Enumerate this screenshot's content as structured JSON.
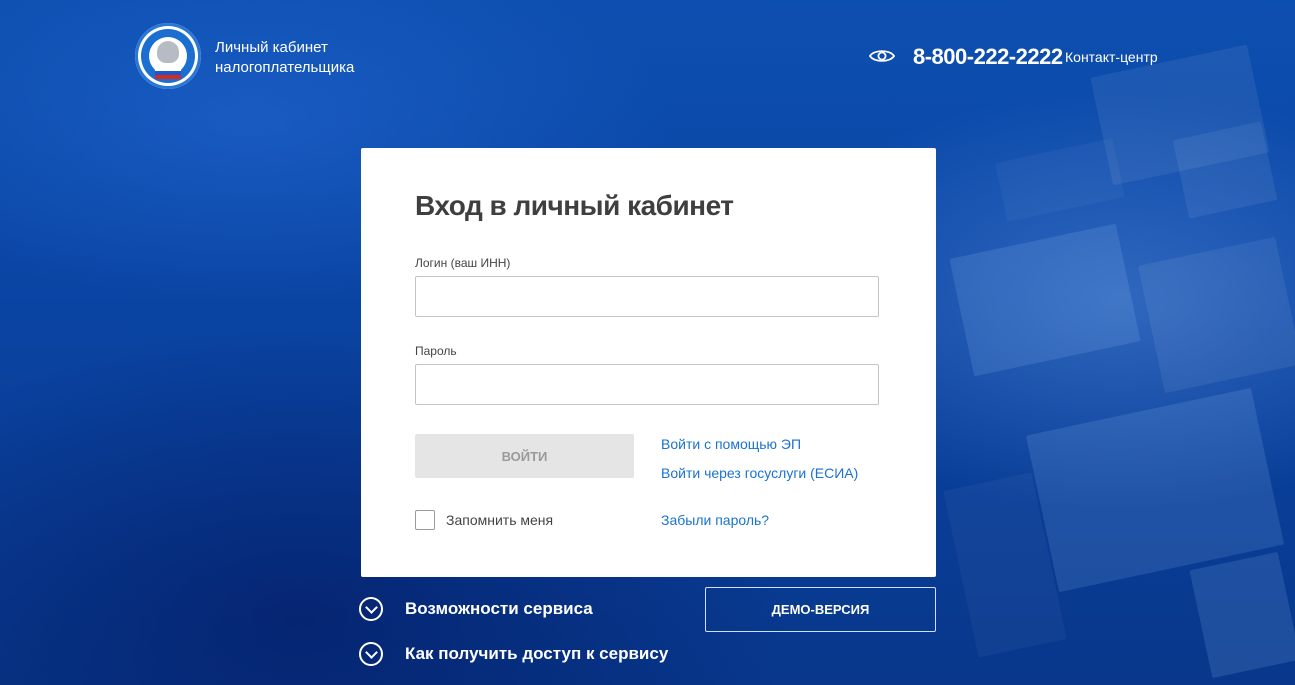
{
  "header": {
    "brand_line1": "Личный кабинет",
    "brand_line2": "налогоплательщика",
    "phone": "8-800-222-2222",
    "contact_label": "Контакт-центр"
  },
  "login_form": {
    "title": "Вход в личный кабинет",
    "login_label": "Логин (ваш ИНН)",
    "login_value": "",
    "password_label": "Пароль",
    "password_value": "",
    "submit_label": "ВОЙТИ",
    "ep_link": "Войти с помощью ЭП",
    "esia_link": "Войти через госуслуги (ЕСИА)",
    "remember_label": "Запомнить меня",
    "remember_checked": false,
    "forgot_link": "Забыли пароль?"
  },
  "footer": {
    "features_label": "Возможности сервиса",
    "access_label": "Как получить доступ к сервису",
    "demo_label": "ДЕМО-ВЕРСИЯ"
  },
  "colors": {
    "background": "#0a44a3",
    "card": "#ffffff",
    "link": "#1a73d0",
    "button_disabled": "#e5e5e5",
    "title_text": "#3f3f3f"
  }
}
